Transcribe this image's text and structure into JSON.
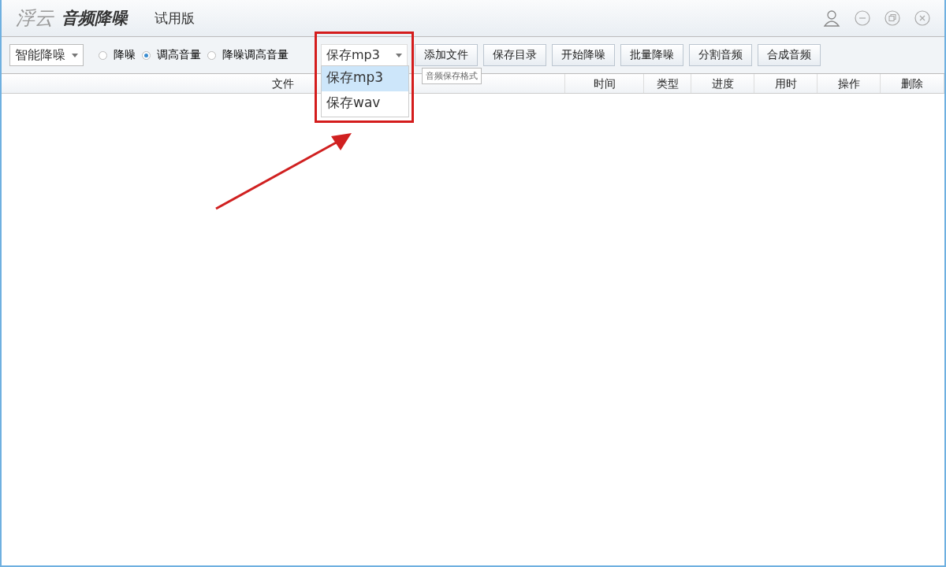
{
  "window": {
    "logo": "浮云",
    "title": "音频降噪",
    "edition": "试用版"
  },
  "mode_select": {
    "value": "智能降噪"
  },
  "radios": [
    {
      "label": "降噪",
      "selected": false
    },
    {
      "label": "调高音量",
      "selected": true
    },
    {
      "label": "降噪调高音量",
      "selected": false
    }
  ],
  "format_select": {
    "value": "保存mp3",
    "expanded": true,
    "options": [
      {
        "label": "保存mp3",
        "selected": true
      },
      {
        "label": "保存wav",
        "selected": false
      }
    ]
  },
  "tooltip": "音频保存格式",
  "buttons": [
    "添加文件",
    "保存目录",
    "开始降噪",
    "批量降噪",
    "分割音频",
    "合成音频"
  ],
  "table": {
    "columns": [
      "文件",
      "时间",
      "类型",
      "进度",
      "用时",
      "操作",
      "删除"
    ]
  }
}
